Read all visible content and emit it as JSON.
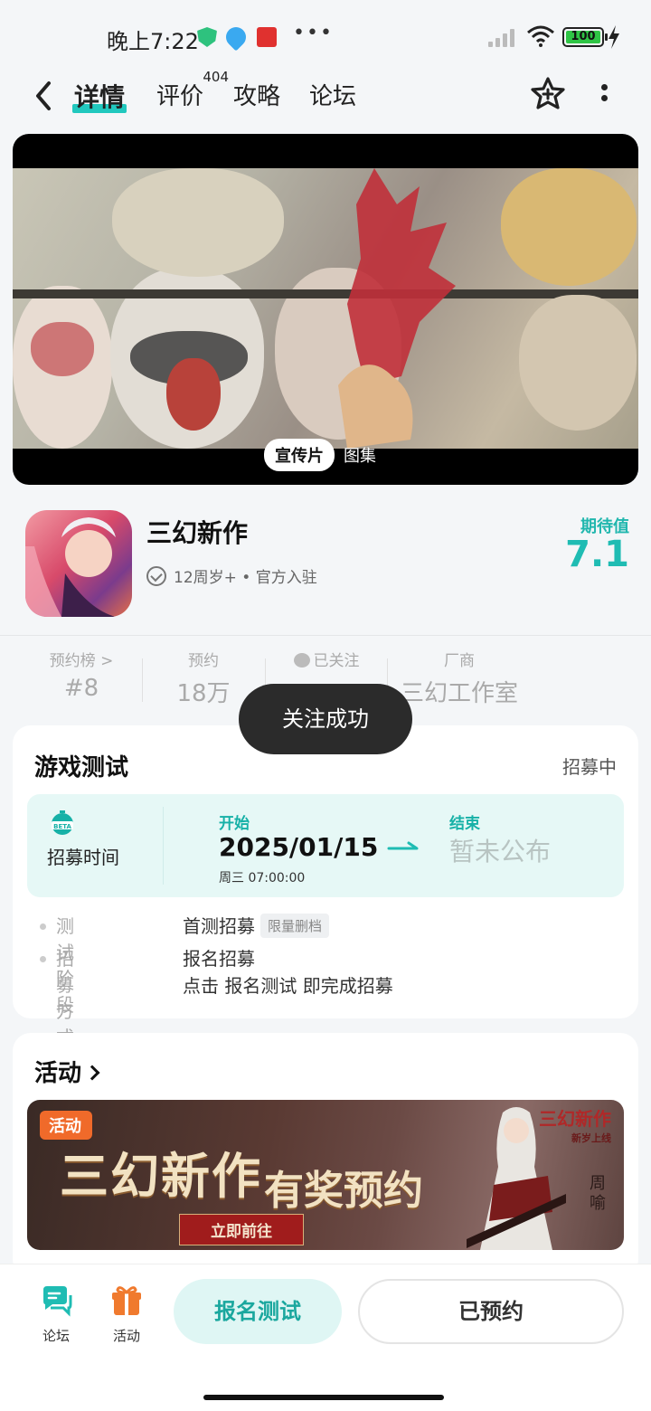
{
  "status_bar": {
    "time": "晚上7:22",
    "battery": "100"
  },
  "nav": {
    "tabs": [
      {
        "label": "详情"
      },
      {
        "label": "评价",
        "count": "404"
      },
      {
        "label": "攻略"
      },
      {
        "label": "论坛"
      }
    ]
  },
  "media": {
    "tab_active": "宣传片",
    "tab_inactive": "图集"
  },
  "app": {
    "name": "三幻新作",
    "meta": "12周岁+ • 官方入驻",
    "expect_label": "期待值",
    "expect_value": "7.1"
  },
  "stats": [
    {
      "label": "预约榜 >",
      "value": "#8"
    },
    {
      "label": "预约",
      "value": "18万"
    },
    {
      "label": "已关注",
      "value": ""
    },
    {
      "label": "厂商",
      "value": "三幻工作室"
    }
  ],
  "toast": "关注成功",
  "test_card": {
    "title": "游戏测试",
    "status": "招募中",
    "recruit_label": "招募时间",
    "beta_text": "BETA",
    "start_label": "开始",
    "start_date": "2025/01/15",
    "start_day": "周三  07:00:00",
    "end_label": "结束",
    "end_value": "暂未公布",
    "rows": [
      {
        "key": "测试阶段",
        "value": "首测招募",
        "tag": "限量删档"
      },
      {
        "key": "招募方式",
        "value": "报名招募",
        "value2": "点击 报名测试 即完成招募"
      }
    ]
  },
  "activity": {
    "title": "活动",
    "banner": {
      "badge": "活动",
      "title": "三幻新作",
      "subtitle": "有奖预约",
      "button": "立即前往",
      "brand": "三幻新作",
      "brand_sub": "新岁上线",
      "character": "周喻"
    }
  },
  "bottom_bar": {
    "forum": "论坛",
    "activity": "活动",
    "signup": "报名测试",
    "reserved": "已预约"
  },
  "colors": {
    "accent": "#21c8be",
    "accent_text": "#16b1a7",
    "toast_bg": "#2b2b2b"
  }
}
